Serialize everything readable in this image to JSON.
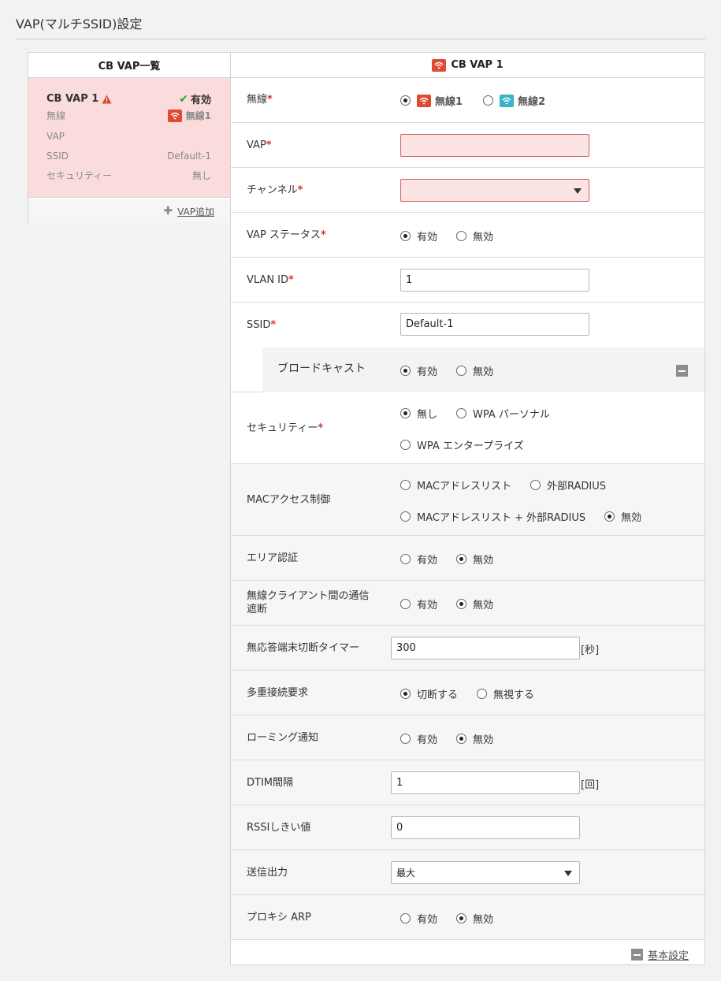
{
  "page": {
    "title": "VAP(マルチSSID)設定"
  },
  "left": {
    "header": "CB VAP一覧",
    "card": {
      "name": "CB VAP 1",
      "status": "有効",
      "wireless_label": "無線",
      "wireless_value": "無線1",
      "vap_label": "VAP",
      "ssid_label": "SSID",
      "ssid_value": "Default-1",
      "security_label": "セキュリティー",
      "security_value": "無し"
    },
    "add_link": "VAP追加"
  },
  "right": {
    "header": "CB VAP 1",
    "required_mark": "*",
    "wireless": {
      "label": "無線",
      "opt1": "無線1",
      "opt2": "無線2",
      "selected": "無線1"
    },
    "vap": {
      "label": "VAP",
      "value": ""
    },
    "channel": {
      "label": "チャンネル",
      "value": ""
    },
    "vap_status": {
      "label": "VAP ステータス",
      "opt1": "有効",
      "opt2": "無効",
      "selected": "有効"
    },
    "vlan": {
      "label": "VLAN ID",
      "value": "1"
    },
    "ssid": {
      "label": "SSID",
      "value": "Default-1"
    },
    "broadcast": {
      "label": "ブロードキャスト",
      "opt1": "有効",
      "opt2": "無効",
      "selected": "有効"
    },
    "security": {
      "label": "セキュリティー",
      "opt1": "無し",
      "opt2": "WPA パーソナル",
      "opt3": "WPA エンタープライズ",
      "selected": "無し"
    },
    "mac": {
      "label": "MACアクセス制御",
      "opt1": "MACアドレスリスト",
      "opt2": "外部RADIUS",
      "opt3": "MACアドレスリスト + 外部RADIUS",
      "opt4": "無効",
      "selected": "無効"
    },
    "area_auth": {
      "label": "エリア認証",
      "opt1": "有効",
      "opt2": "無効",
      "selected": "無効"
    },
    "isolation": {
      "label": "無線クライアント間の通信遮断",
      "opt1": "有効",
      "opt2": "無効",
      "selected": "無効"
    },
    "timer": {
      "label": "無応答端末切断タイマー",
      "value": "300",
      "unit": "[秒]"
    },
    "multi": {
      "label": "多重接続要求",
      "opt1": "切断する",
      "opt2": "無視する",
      "selected": "切断する"
    },
    "roaming": {
      "label": "ローミング通知",
      "opt1": "有効",
      "opt2": "無効",
      "selected": "無効"
    },
    "dtim": {
      "label": "DTIM間隔",
      "value": "1",
      "unit": "[回]"
    },
    "rssi": {
      "label": "RSSIしきい値",
      "value": "0"
    },
    "power": {
      "label": "送信出力",
      "value": "最大"
    },
    "proxy_arp": {
      "label": "プロキシ ARP",
      "opt1": "有効",
      "opt2": "無効",
      "selected": "無効"
    },
    "basic_link": "基本設定"
  },
  "icons": {
    "wifi": "wifi-icon",
    "warning": "warning-icon",
    "check": "check-icon",
    "plus": "plus-icon",
    "minus": "minus-icon",
    "dropdown": "chevron-down-icon"
  },
  "colors": {
    "error_bg": "#fde4e4",
    "card_bg": "#fadcdc",
    "wifi1": "#e04a32",
    "wifi2": "#3ab3c8",
    "required": "#dd3333"
  }
}
